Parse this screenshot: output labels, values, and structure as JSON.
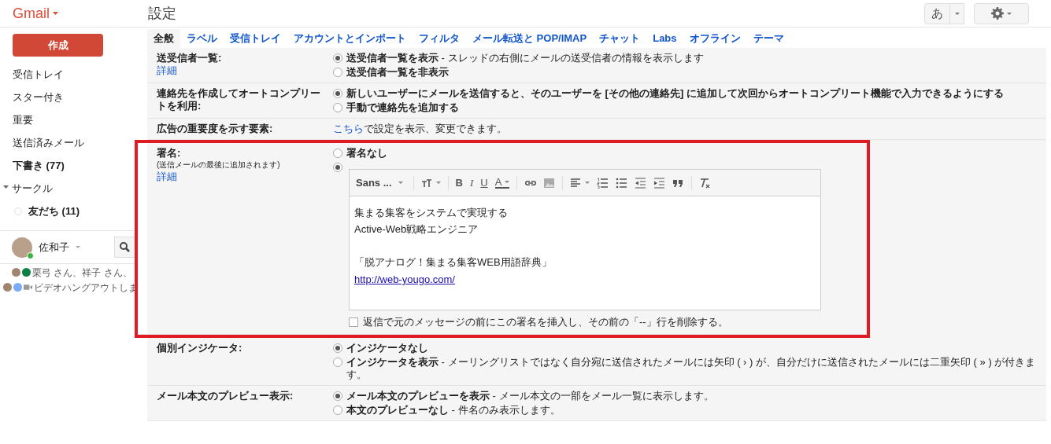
{
  "header": {
    "logo": "Gmail",
    "title": "設定",
    "input_tool": "あ"
  },
  "sidebar": {
    "compose": "作成",
    "items": [
      {
        "label": "受信トレイ",
        "bold": false
      },
      {
        "label": "スター付き",
        "bold": false
      },
      {
        "label": "重要",
        "bold": false
      },
      {
        "label": "送信済みメール",
        "bold": false
      },
      {
        "label": "下書き (77)",
        "bold": true
      }
    ],
    "circles": {
      "label": "サークル",
      "expanded": true,
      "children": [
        {
          "label": "友だち (11)"
        }
      ]
    },
    "chat": {
      "user": "佐和子",
      "contacts": [
        "栗弓 さん、祥子 さん、",
        "ビデオハングアウトしま"
      ]
    }
  },
  "tabs": [
    {
      "label": "全般",
      "selected": true
    },
    {
      "label": "ラベル",
      "selected": false
    },
    {
      "label": "受信トレイ",
      "selected": false
    },
    {
      "label": "アカウントとインポート",
      "selected": false
    },
    {
      "label": "フィルタ",
      "selected": false
    },
    {
      "label": "メール転送と POP/IMAP",
      "selected": false
    },
    {
      "label": "チャット",
      "selected": false
    },
    {
      "label": "Labs",
      "selected": false
    },
    {
      "label": "オフライン",
      "selected": false
    },
    {
      "label": "テーマ",
      "selected": false
    }
  ],
  "settings": [
    {
      "kind": "radios",
      "label": "送受信者一覧:",
      "link": "詳細",
      "options": [
        {
          "label": "送受信者一覧を表示",
          "description": "- スレッドの右側にメールの送受信者の情報を表示します",
          "selected": true
        },
        {
          "label": "送受信者一覧を非表示",
          "selected": false
        }
      ]
    },
    {
      "kind": "radios",
      "label": "連絡先を作成してオートコンプリートを利用:",
      "options": [
        {
          "label": "新しいユーザーにメールを送信すると、そのユーザーを [その他の連絡先] に追加して次回からオートコンプリート機能で入力できるようにする",
          "selected": true
        },
        {
          "label": "手動で連絡先を追加する",
          "selected": false
        }
      ]
    },
    {
      "kind": "link_text",
      "label": "広告の重要度を示す要素:",
      "link": "こちら",
      "text": "で設定を表示、変更できます。"
    },
    {
      "kind": "signature",
      "label": "署名:",
      "note": "(送信メールの最後に追加されます)",
      "link": "詳細",
      "highlighted": true,
      "options": [
        {
          "label": "署名なし",
          "selected": false
        },
        {
          "selected": true
        }
      ],
      "toolbar": [
        {
          "kind": "font",
          "label": "Sans ..."
        },
        {
          "kind": "size"
        },
        {
          "kind": "letter",
          "label": "B"
        },
        {
          "kind": "letter",
          "label": "I"
        },
        {
          "kind": "letter",
          "label": "U"
        },
        {
          "kind": "color",
          "label": "A"
        },
        {
          "kind": "link"
        },
        {
          "kind": "image"
        },
        {
          "kind": "align"
        },
        {
          "kind": "numbered"
        },
        {
          "kind": "bulleted"
        },
        {
          "kind": "outdent"
        },
        {
          "kind": "indent"
        },
        {
          "kind": "quote"
        },
        {
          "kind": "clear"
        }
      ],
      "body": [
        {
          "kind": "text",
          "text": "集まる集客をシステムで実現する"
        },
        {
          "kind": "text",
          "text": "Active-Web戦略エンジニア"
        },
        {
          "kind": "blank"
        },
        {
          "kind": "text",
          "text": "「脱アナログ！集まる集客WEB用語辞典」"
        },
        {
          "kind": "link",
          "text": "http://web-yougo.com/"
        }
      ],
      "checkbox": {
        "label": "返信で元のメッセージの前にこの署名を挿入し、その前の「--」行を削除する。",
        "checked": false
      }
    },
    {
      "kind": "radios",
      "label": "個別インジケータ:",
      "options": [
        {
          "label": "インジケータなし",
          "selected": true
        },
        {
          "label": "インジケータを表示",
          "description": "- メーリングリストではなく自分宛に送信されたメールには矢印 ( › ) が、自分だけに送信されたメールには二重矢印 ( » ) が付きます。",
          "selected": false
        }
      ]
    },
    {
      "kind": "radios",
      "label": "メール本文のプレビュー表示:",
      "options": [
        {
          "label": "メール本文のプレビューを表示",
          "description": "- メール本文の一部をメール一覧に表示します。",
          "selected": true
        },
        {
          "label": "本文のプレビューなし",
          "description": "- 件名のみ表示します。",
          "selected": false
        }
      ]
    }
  ]
}
